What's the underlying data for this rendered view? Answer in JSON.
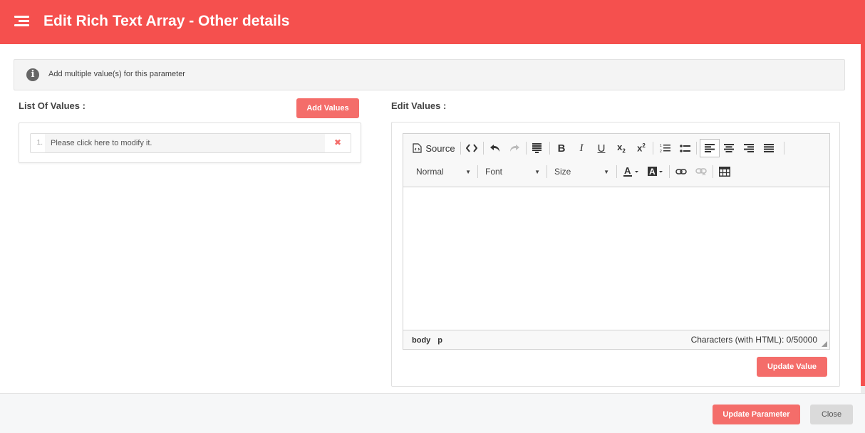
{
  "header": {
    "title": "Edit Rich Text Array - Other details",
    "icon": "menu-icon"
  },
  "info": {
    "text": "Add multiple value(s) for this parameter",
    "icon": "info-icon"
  },
  "left": {
    "label": "List Of Values :",
    "add_button": "Add Values",
    "items": [
      {
        "num": "1.",
        "value": "Please click here to modify it.",
        "delete": "✖"
      }
    ]
  },
  "right": {
    "label": "Edit Values :",
    "toolbar": {
      "source": "Source",
      "format": "Normal",
      "font": "Font",
      "size": "Size"
    },
    "status": {
      "path": [
        "body",
        "p"
      ],
      "count": "Characters (with HTML): 0/50000"
    },
    "update_button": "Update Value"
  },
  "footer": {
    "update_parameter": "Update Parameter",
    "close": "Close"
  },
  "colors": {
    "accent": "#f5504e",
    "button": "#f46d6a",
    "close_bg": "#dadada"
  }
}
